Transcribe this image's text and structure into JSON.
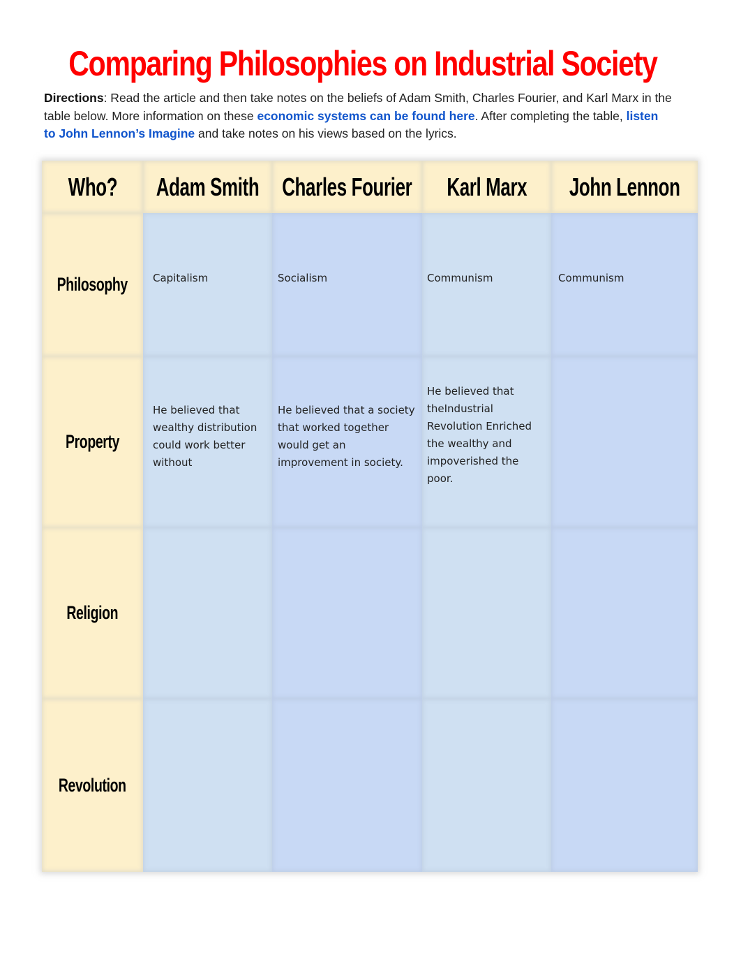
{
  "document": {
    "title": "Comparing Philosophies on Industrial Society",
    "directions": {
      "label": "Directions",
      "text_1": ": Read the article and then take notes on the beliefs of Adam Smith, Charles Fourier, and Karl Marx in the table below. More information on these ",
      "link_1": "economic systems can be found here",
      "text_2": ". After completing the table, ",
      "link_2": "listen to John Lennon’s Imagine",
      "text_3": " and take notes on his views based on the lyrics."
    },
    "colors": {
      "title": "#ff0000",
      "link": "#1155cc",
      "header_bg": "#fdf0cb",
      "column_blue_light": "#cfe0f2",
      "column_blue_periwinkle": "#c8d9f5"
    }
  },
  "table": {
    "corner_header": "Who?",
    "columns": [
      "Adam Smith",
      "Charles Fourier",
      "Karl Marx",
      "John Lennon"
    ],
    "rows": [
      {
        "label": "Philosophy",
        "cells": [
          "Capitalism",
          "Socialism",
          "Communism",
          "Communism"
        ]
      },
      {
        "label": "Property",
        "cells": [
          "He believed that wealthy distribution could work better without",
          "He believed that a society that worked together would get an improvement in society.",
          "He believed that theIndustrial Revolution Enriched the wealthy and impoverished the poor.",
          ""
        ]
      },
      {
        "label": "Religion",
        "cells": [
          "",
          "",
          "",
          ""
        ]
      },
      {
        "label": "Revolution",
        "cells": [
          "",
          "",
          "",
          ""
        ]
      }
    ]
  }
}
